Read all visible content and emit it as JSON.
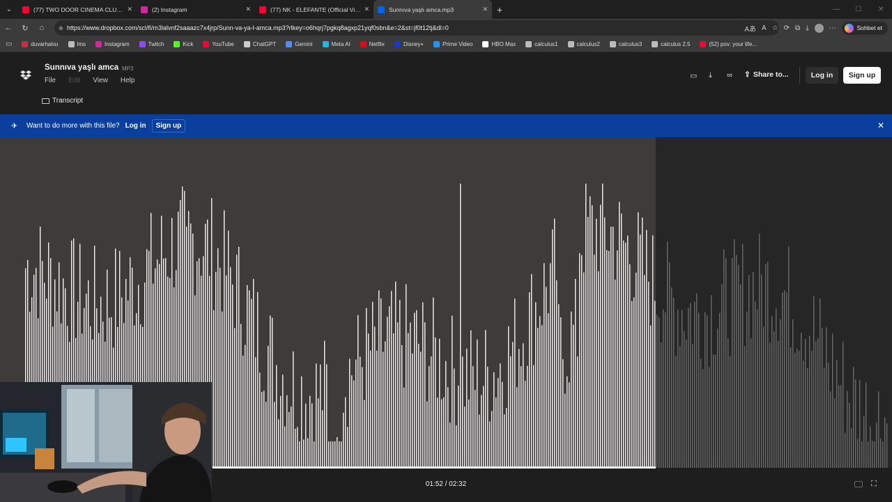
{
  "browser": {
    "tabs": [
      {
        "title": "(77) TWO DOOR CINEMA CLUB | S",
        "icon": "youtube-icon",
        "color": "#ff0033"
      },
      {
        "title": "(2) Instagram",
        "icon": "instagram-icon",
        "color": "#d6249f"
      },
      {
        "title": "(77) NK - ELEFANTE (Official Video",
        "icon": "youtube-icon",
        "color": "#ff0033"
      },
      {
        "title": "Sunnıva yaşlı amca.mp3",
        "icon": "dropbox-icon",
        "color": "#0061fe",
        "active": true
      }
    ],
    "url": "https://www.dropbox.com/scl/fi/m3lalvnf2saaazc7x4jrp/Sunn-va-ya-l-amca.mp3?rlkey=o6hqrj7pgkq8agxp21yqf0sbn&e=2&st=jf0t12tj&dl=0",
    "copilot_label": "Sohbet et",
    "bookmarks": [
      {
        "label": "duvarhalısı",
        "icon": "globe-icon",
        "color": "#c7303c"
      },
      {
        "label": "lms",
        "icon": "globe-icon",
        "color": "#bbbbbb"
      },
      {
        "label": "Instagram",
        "icon": "instagram-icon",
        "color": "#d6249f"
      },
      {
        "label": "Twitch",
        "icon": "twitch-icon",
        "color": "#9146ff"
      },
      {
        "label": "Kick",
        "icon": "kick-icon",
        "color": "#53fc18"
      },
      {
        "label": "YouTube",
        "icon": "youtube-icon",
        "color": "#ff0033"
      },
      {
        "label": "ChatGPT",
        "icon": "chatgpt-icon",
        "color": "#cccccc"
      },
      {
        "label": "Gemini",
        "icon": "gemini-icon",
        "color": "#4f8cff"
      },
      {
        "label": "Meta AI",
        "icon": "meta-ai-icon",
        "color": "#1fb5e8"
      },
      {
        "label": "Netflix",
        "icon": "netflix-icon",
        "color": "#e50914"
      },
      {
        "label": "Disney+",
        "icon": "disney-icon",
        "color": "#113ccf"
      },
      {
        "label": "Prime Video",
        "icon": "prime-video-icon",
        "color": "#1a98ff"
      },
      {
        "label": "HBO Max",
        "icon": "hbo-max-icon",
        "color": "#ffffff"
      },
      {
        "label": "calculus1",
        "icon": "globe-icon",
        "color": "#bbbbbb"
      },
      {
        "label": "calculus2",
        "icon": "globe-icon",
        "color": "#bbbbbb"
      },
      {
        "label": "calculus3",
        "icon": "globe-icon",
        "color": "#bbbbbb"
      },
      {
        "label": "calculus 2.5",
        "icon": "globe-icon",
        "color": "#bbbbbb"
      },
      {
        "label": "(52) pov: your life...",
        "icon": "youtube-icon",
        "color": "#ff0033"
      }
    ]
  },
  "file": {
    "title": "Sunnıva yaşlı amca",
    "ext": "MP3"
  },
  "menu": {
    "file": "File",
    "edit": "Edit",
    "view": "View",
    "help": "Help",
    "transcript": "Transcript"
  },
  "header": {
    "share": "Share to...",
    "login": "Log in",
    "signup": "Sign up"
  },
  "banner": {
    "text": "Want to do more with this file?",
    "login": "Log in",
    "signup": "Sign up"
  },
  "player": {
    "time": "01:52 / 02:32",
    "current_seconds": 112,
    "total_seconds": 152,
    "progress": 0.737
  },
  "colors": {
    "banner": "#0a3f9e",
    "played_wave": "#f2f2f2",
    "unplayed_wave": "#6a6a6a",
    "played_bg": "#3e3c3b",
    "unplayed_bg": "#262626"
  }
}
